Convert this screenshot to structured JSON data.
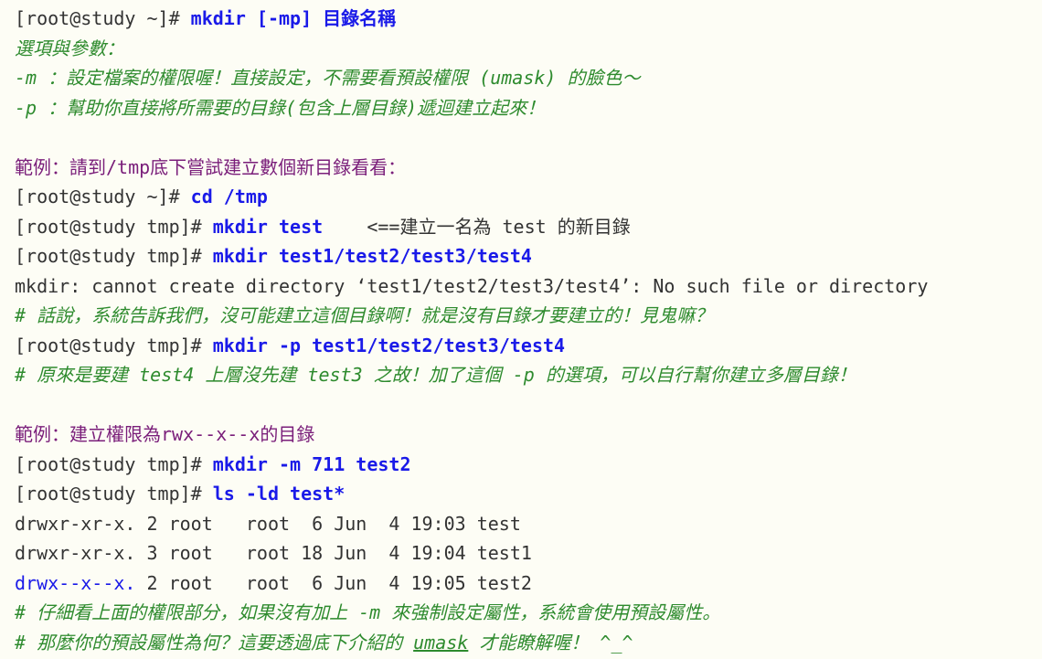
{
  "prompt_home": "[root@study ~]# ",
  "prompt_tmp": "[root@study tmp]# ",
  "syntax": {
    "command": "mkdir [-mp] 目錄名稱",
    "options_title": "選項與參數：",
    "opt_m": "-m ：設定檔案的權限喔！直接設定，不需要看預設權限 (umask) 的臉色～",
    "opt_p": "-p ：幫助你直接將所需要的目錄(包含上層目錄)遞迴建立起來！"
  },
  "example1": {
    "title": "範例：請到/tmp底下嘗試建立數個新目錄看看：",
    "cmd_cd": "cd /tmp",
    "cmd_mkdir_test": "mkdir test",
    "note_test": "    <==建立一名為 test 的新目錄",
    "cmd_mkdir_nested": "mkdir test1/test2/test3/test4",
    "error": "mkdir: cannot create directory ‘test1/test2/test3/test4’: No such file or directory",
    "comment1": "# 話說，系統告訴我們，沒可能建立這個目錄啊！就是沒有目錄才要建立的！見鬼嘛？",
    "cmd_mkdir_p": "mkdir -p test1/test2/test3/test4",
    "comment2": "# 原來是要建 test4 上層沒先建 test3 之故！加了這個 -p 的選項，可以自行幫你建立多層目錄！"
  },
  "example2": {
    "title": "範例：建立權限為rwx--x--x的目錄",
    "cmd_mkdir_m": "mkdir -m 711 test2",
    "cmd_ls": "ls -ld test*",
    "listing": [
      {
        "perm": "drwxr-xr-x.",
        "rest": " 2 root   root  6 Jun  4 19:03 test",
        "highlight": false
      },
      {
        "perm": "drwxr-xr-x.",
        "rest": " 3 root   root 18 Jun  4 19:04 test1",
        "highlight": false
      },
      {
        "perm": "drwx--x--x.",
        "rest": " 2 root   root  6 Jun  4 19:05 test2",
        "highlight": true
      }
    ],
    "comment3": "# 仔細看上面的權限部分，如果沒有加上 -m 來強制設定屬性，系統會使用預設屬性。",
    "comment4_a": "# 那麼你的預設屬性為何？這要透過底下介紹的 ",
    "comment4_link": "umask",
    "comment4_b": " 才能瞭解喔！ ^_^"
  }
}
